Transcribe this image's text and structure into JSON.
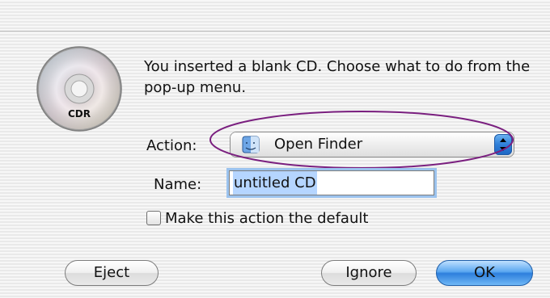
{
  "dialog": {
    "message": "You inserted a blank CD. Choose what to do from the pop-up menu.",
    "icon": "cd-r-disc-icon",
    "icon_badge_text": "CDR"
  },
  "action": {
    "label": "Action:",
    "selected_value": "Open Finder",
    "selected_icon": "finder-icon",
    "highlighted": true,
    "highlight_color": "#7a1f7f"
  },
  "name": {
    "label": "Name:",
    "value": "untitled CD"
  },
  "default_checkbox": {
    "label": "Make this action the default",
    "checked": false
  },
  "buttons": {
    "eject": "Eject",
    "ignore": "Ignore",
    "ok": "OK"
  },
  "colors": {
    "default_button": "#2d7fdc",
    "focus_ring": "#9cc3ee",
    "text_selection": "#b5d5ff"
  }
}
